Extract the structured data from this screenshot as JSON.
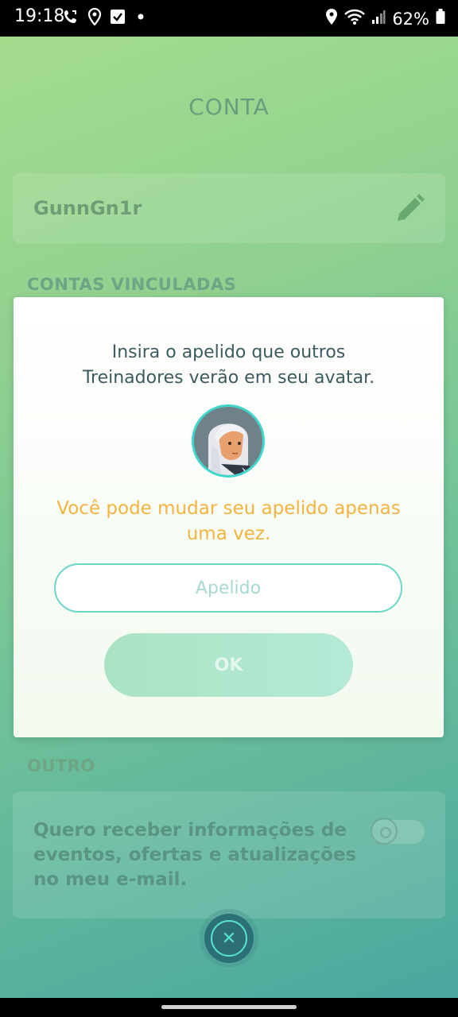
{
  "status_bar": {
    "time": "19:18",
    "battery": "62%",
    "left_icons": [
      "call-forward-icon",
      "location-icon",
      "checkbox-icon",
      "dot-icon"
    ],
    "right_icons": [
      "location-icon",
      "wifi-icon",
      "signal-icon",
      "battery-icon"
    ]
  },
  "screen": {
    "title": "CONTA",
    "username": "GunnGn1r",
    "linked_accounts_label": "CONTAS VINCULADAS",
    "other_label": "OUTRO",
    "email_pref_text": "Quero receber informações de eventos, ofertas e atualizações no meu e-mail.",
    "email_pref_enabled": false
  },
  "dialog": {
    "prompt_line1": "Insira o apelido que outros",
    "prompt_line2": "Treinadores verão em seu avatar.",
    "warning_line1": "Você pode mudar seu apelido apenas",
    "warning_line2": "uma vez.",
    "nickname_value": "",
    "nickname_placeholder": "Apelido",
    "ok_label": "OK"
  },
  "colors": {
    "accent_teal": "#3fd6cb",
    "warning_orange": "#f2b43f",
    "background_green": "#8fd090"
  }
}
